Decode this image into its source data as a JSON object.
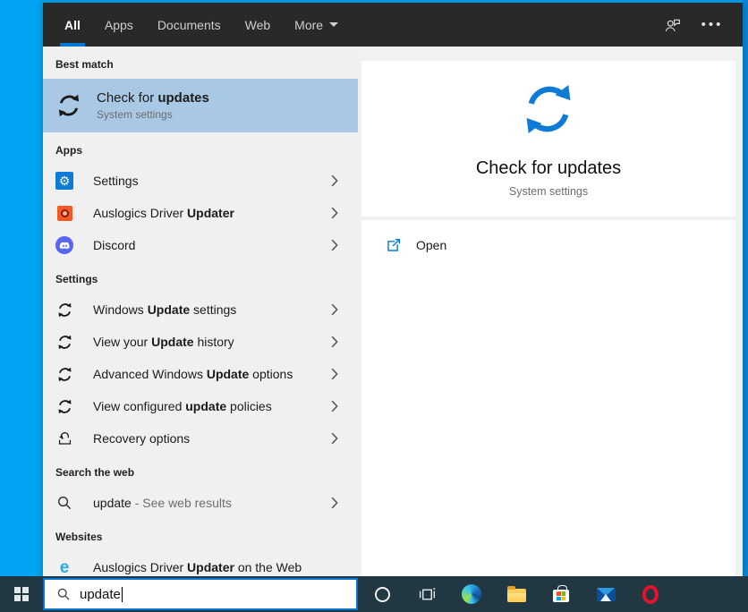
{
  "topbar": {
    "tabs": [
      {
        "label": "All",
        "active": true,
        "dropdown": false
      },
      {
        "label": "Apps",
        "active": false,
        "dropdown": false
      },
      {
        "label": "Documents",
        "active": false,
        "dropdown": false
      },
      {
        "label": "Web",
        "active": false,
        "dropdown": false
      },
      {
        "label": "More",
        "active": false,
        "dropdown": true
      }
    ],
    "right_icons": [
      {
        "name": "feedback-person-icon"
      },
      {
        "name": "ellipsis-menu-icon",
        "glyph": "•••"
      }
    ]
  },
  "results": {
    "sections": [
      {
        "header": "Best match",
        "items": [
          {
            "name": "best-match-check-for-updates",
            "icon": "sync",
            "parts": [
              {
                "text": "Check for "
              },
              {
                "text": "updates",
                "bold": true
              }
            ],
            "subtitle": "System settings",
            "selected": true,
            "chevron": false
          }
        ]
      },
      {
        "header": "Apps",
        "items": [
          {
            "name": "app-settings",
            "icon": "settings",
            "parts": [
              {
                "text": "Settings"
              }
            ],
            "chevron": true
          },
          {
            "name": "app-auslogics-driver-updater",
            "icon": "auslogics",
            "parts": [
              {
                "text": "Auslogics Driver "
              },
              {
                "text": "Updater",
                "bold": true
              }
            ],
            "chevron": true
          },
          {
            "name": "app-discord",
            "icon": "discord",
            "parts": [
              {
                "text": "Discord"
              }
            ],
            "chevron": true
          }
        ]
      },
      {
        "header": "Settings",
        "items": [
          {
            "name": "setting-windows-update-settings",
            "icon": "sync",
            "parts": [
              {
                "text": "Windows "
              },
              {
                "text": "Update",
                "bold": true
              },
              {
                "text": " settings"
              }
            ],
            "chevron": true
          },
          {
            "name": "setting-view-your-update-history",
            "icon": "sync",
            "parts": [
              {
                "text": "View your "
              },
              {
                "text": "Update",
                "bold": true
              },
              {
                "text": " history"
              }
            ],
            "chevron": true
          },
          {
            "name": "setting-advanced-windows-update-options",
            "icon": "sync",
            "parts": [
              {
                "text": "Advanced Windows "
              },
              {
                "text": "Update",
                "bold": true
              },
              {
                "text": " options"
              }
            ],
            "chevron": true
          },
          {
            "name": "setting-view-configured-update-policies",
            "icon": "sync",
            "parts": [
              {
                "text": "View configured "
              },
              {
                "text": "update",
                "bold": true
              },
              {
                "text": " policies"
              }
            ],
            "chevron": true
          },
          {
            "name": "setting-recovery-options",
            "icon": "recovery",
            "parts": [
              {
                "text": "Recovery options"
              }
            ],
            "chevron": true
          }
        ]
      },
      {
        "header": "Search the web",
        "items": [
          {
            "name": "web-search-update",
            "icon": "search",
            "parts": [
              {
                "text": "update"
              },
              {
                "text": " - See web results",
                "muted": true
              }
            ],
            "chevron": true
          }
        ]
      },
      {
        "header": "Websites",
        "items": [
          {
            "name": "website-auslogics-driver-updater",
            "icon": "globe-e",
            "parts": [
              {
                "text": "Auslogics Driver "
              },
              {
                "text": "Updater",
                "bold": true
              },
              {
                "text": " on the Web"
              }
            ],
            "chevron": false
          }
        ]
      }
    ]
  },
  "preview": {
    "icon": "sync",
    "title": "Check for updates",
    "subtitle": "System settings",
    "actions": [
      {
        "name": "open",
        "icon": "open-external",
        "label": "Open"
      }
    ]
  },
  "taskbar": {
    "search": {
      "value": "update",
      "icon": "search"
    },
    "buttons": [
      "start",
      "cortana",
      "task-view",
      "edge",
      "file-explorer",
      "store",
      "mail",
      "opera"
    ]
  },
  "colors": {
    "accent": "#0078d7",
    "desktop_blue": "#00a4f2",
    "desktop_blue_right": "#0b84d6",
    "highlight": "#a9c8e6",
    "topbar_bg": "#292929",
    "taskbar_bg": "#213843",
    "hero_icon_blue": "#0f7bd7"
  }
}
